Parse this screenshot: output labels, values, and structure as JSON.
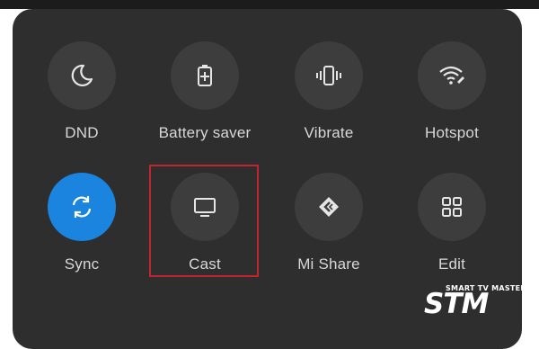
{
  "tiles": [
    {
      "label": "DND",
      "icon": "moon-icon",
      "active": false
    },
    {
      "label": "Battery saver",
      "icon": "battery-plus-icon",
      "active": false
    },
    {
      "label": "Vibrate",
      "icon": "vibrate-icon",
      "active": false
    },
    {
      "label": "Hotspot",
      "icon": "wifi-hotspot-icon",
      "active": false
    },
    {
      "label": "Sync",
      "icon": "sync-icon",
      "active": true
    },
    {
      "label": "Cast",
      "icon": "monitor-icon",
      "active": false
    },
    {
      "label": "Mi Share",
      "icon": "mi-share-icon",
      "active": false
    },
    {
      "label": "Edit",
      "icon": "grid-icon",
      "active": false
    }
  ],
  "colors": {
    "panel": "#2e2e2e",
    "tile_bg": "#3d3d3d",
    "active": "#1a84de",
    "highlight": "#c2252d",
    "label": "#d8d8d8"
  },
  "watermark": {
    "top": "SMART TV MASTER",
    "big": "STM"
  }
}
